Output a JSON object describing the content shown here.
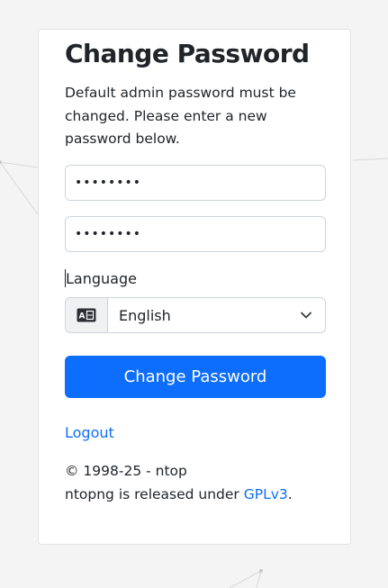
{
  "title": "Change Password",
  "description": "Default admin password must be changed. Please enter a new password below.",
  "password_field_1": {
    "value": "••••••••"
  },
  "password_field_2": {
    "value": "••••••••"
  },
  "language": {
    "label": "Language",
    "selected": "English",
    "icon": "language-card-icon"
  },
  "submit_label": "Change Password",
  "logout_label": "Logout",
  "footer": {
    "copyright": "© 1998-25 - ntop",
    "license_prefix": "ntopng is released under ",
    "license_link": "GPLv3",
    "license_suffix": "."
  },
  "colors": {
    "accent": "#0d6efd",
    "background": "#f4f4f4",
    "card": "#ffffff"
  }
}
